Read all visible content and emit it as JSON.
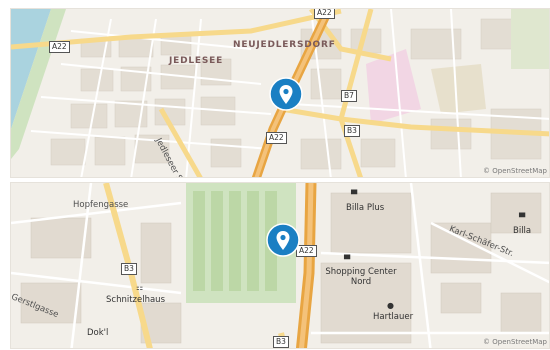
{
  "maps": [
    {
      "district_labels": [
        "JEDLESEE",
        "NEUJEDLERSDORF"
      ],
      "road_shields": [
        "A22",
        "A22",
        "A22",
        "B7",
        "B3"
      ],
      "street_labels": [
        "Jedleseer Str."
      ],
      "attribution": "© OpenStreetMap",
      "marker": "location-pin-icon"
    },
    {
      "street_labels": [
        "Hopfengasse",
        "Gerstlgasse",
        "Karl-Schäfer-Str."
      ],
      "poi_labels": [
        "Billa Plus",
        "Billa",
        "Schnitzelhaus",
        "Shopping Center Nord",
        "Hartlauer",
        "Dok'l"
      ],
      "road_shields": [
        "B3",
        "A22",
        "B3"
      ],
      "attribution": "© OpenStreetMap",
      "marker": "location-pin-icon"
    }
  ],
  "colors": {
    "pin": "#1a7fc3",
    "motorway": "#e8a542",
    "primary_road": "#f7d98b",
    "water": "#aad3df",
    "park": "#c8e0b4",
    "land": "#f2efe9",
    "building": "#ddd6cc",
    "industrial": "#f2d6e4"
  }
}
